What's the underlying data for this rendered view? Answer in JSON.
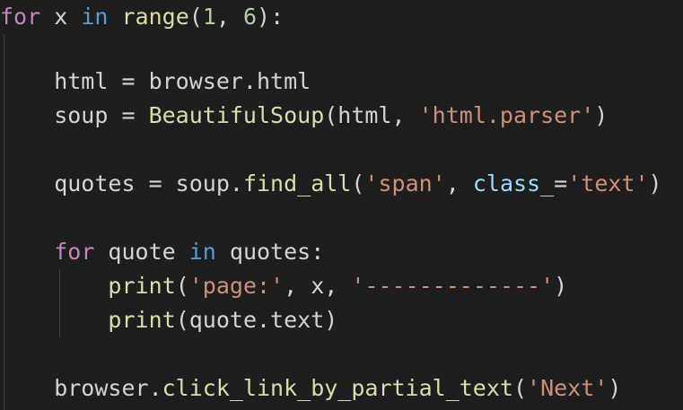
{
  "code": {
    "line1": {
      "kw_for": "for",
      "t1": " x ",
      "kw_in": "in",
      "t2": " ",
      "fn_range": "range",
      "t3": "(",
      "num1": "1",
      "t4": ", ",
      "num2": "6",
      "t5": "):"
    },
    "line3": {
      "text": "    html = browser.html"
    },
    "line4": {
      "t1": "    soup = ",
      "fn": "BeautifulSoup",
      "t2": "(html, ",
      "str": "'html.parser'",
      "t3": ")"
    },
    "line6": {
      "t1": "    quotes = soup.",
      "fn": "find_all",
      "t2": "(",
      "str1": "'span'",
      "t3": ", ",
      "param": "class_",
      "t4": "=",
      "str2": "'text'",
      "t5": ")"
    },
    "line8": {
      "t1": "    ",
      "kw_for": "for",
      "t2": " quote ",
      "kw_in": "in",
      "t3": " quotes:"
    },
    "line9": {
      "t1": "        ",
      "fn": "print",
      "t2": "(",
      "str1": "'page:'",
      "t3": ", x, ",
      "str2": "'-------------'",
      "t4": ")"
    },
    "line10": {
      "t1": "        ",
      "fn": "print",
      "t2": "(quote.text)"
    },
    "line12": {
      "t1": "    browser.",
      "fn": "click_link_by_partial_text",
      "t2": "(",
      "str": "'Next'",
      "t3": ")"
    }
  },
  "colors": {
    "background": "#1e1e1e",
    "control_keyword": "#c586c0",
    "builtin_keyword": "#569cd6",
    "function": "#dcdcaa",
    "number": "#b5cea8",
    "string": "#ce9178",
    "parameter": "#9cdcfe",
    "text": "#d4d4d4"
  }
}
